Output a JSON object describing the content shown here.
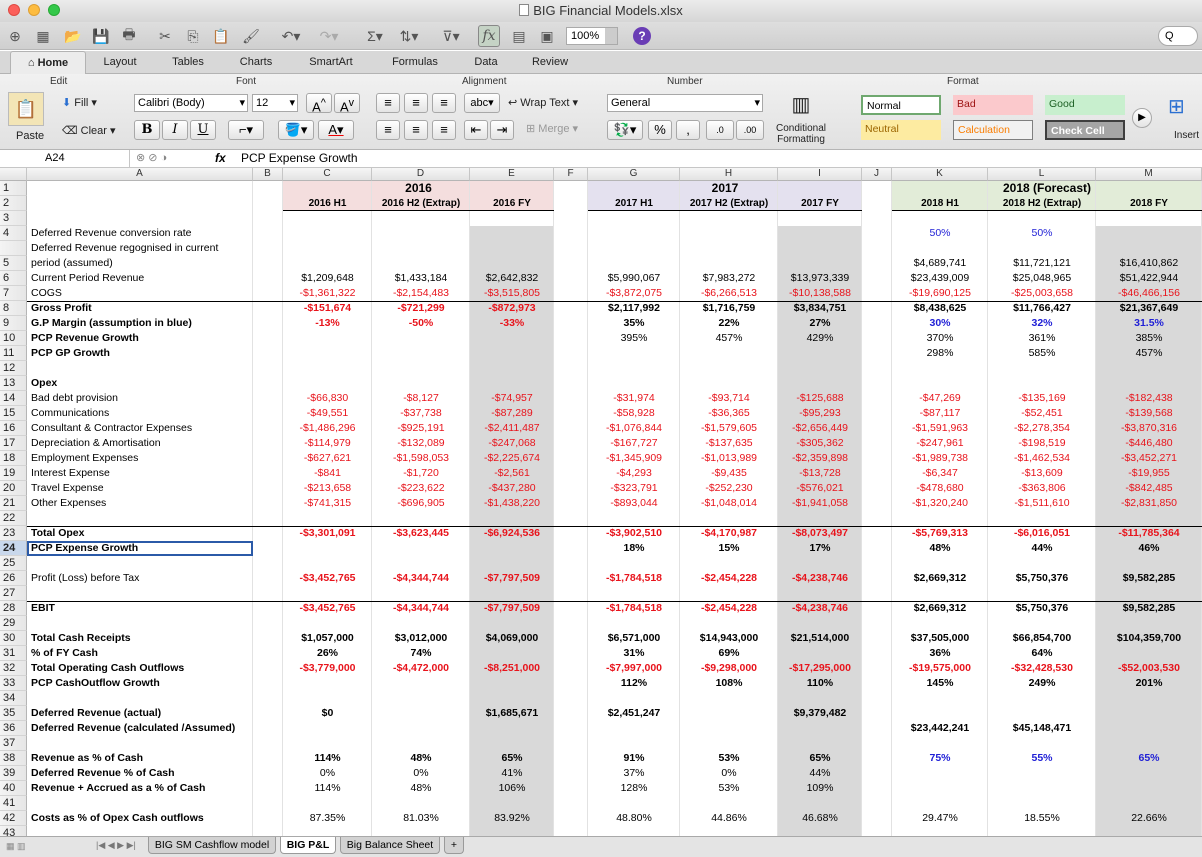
{
  "window": {
    "title": "BIG Financial Models.xlsx"
  },
  "toolbar": {
    "zoom": "100%",
    "search_placeholder": "Q"
  },
  "ribbon_tabs": [
    "Home",
    "Layout",
    "Tables",
    "Charts",
    "SmartArt",
    "Formulas",
    "Data",
    "Review"
  ],
  "ribbon": {
    "groups": {
      "edit": "Edit",
      "font": "Font",
      "alignment": "Alignment",
      "number": "Number",
      "format": "Format"
    },
    "paste": "Paste",
    "fill": "Fill",
    "clear": "Clear",
    "font_name": "Calibri (Body)",
    "font_size": "12",
    "wrap_text": "Wrap Text",
    "merge": "Merge",
    "abc": "abc",
    "number_format": "General",
    "conditional_formatting": "Conditional Formatting",
    "styles": {
      "normal": "Normal",
      "bad": "Bad",
      "good": "Good",
      "neutral": "Neutral",
      "calculation": "Calculation",
      "check_cell": "Check Cell"
    },
    "insert": "Insert"
  },
  "formula_bar": {
    "cell_ref": "A24",
    "fx": "fx",
    "content": "PCP Expense Growth"
  },
  "columns": [
    "A",
    "B",
    "C",
    "D",
    "E",
    "F",
    "G",
    "H",
    "I",
    "J",
    "K",
    "L",
    "M"
  ],
  "header": {
    "year2016": "2016",
    "year2017": "2017",
    "year2018": "2018 (Forecast)",
    "c": "2016 H1",
    "d": "2016 H2 (Extrap)",
    "e": "2016 FY",
    "g": "2017 H1",
    "h": "2017 H2 (Extrap)",
    "i": "2017 FY",
    "k": "2018 H1",
    "l": "2018 H2 (Extrap)",
    "m": "2018 FY"
  },
  "labels": {
    "r4": "Deferred Revenue conversion rate",
    "r5a": "Deferred Revenue regognised in current",
    "r5b": "period (assumed)",
    "r6": "Current Period Revenue",
    "r7": "COGS",
    "r8": "Gross Profit",
    "r9": "G.P Margin (assumption in blue)",
    "r10": "PCP Revenue Growth",
    "r11": "PCP GP Growth",
    "r13": "Opex",
    "r14": "Bad debt provision",
    "r15": "Communications",
    "r16": "Consultant & Contractor Expenses",
    "r17": "Depreciation & Amortisation",
    "r18": "Employment Expenses",
    "r19": "Interest Expense",
    "r20": "Travel Expense",
    "r21": "Other Expenses",
    "r23": "Total Opex",
    "r24": "PCP Expense Growth",
    "r26": "Profit (Loss) before Tax",
    "r28": "EBIT",
    "r30": "Total Cash Receipts",
    "r31": "% of FY Cash",
    "r32": "Total Operating Cash Outflows",
    "r33": "PCP CashOutflow Growth",
    "r35": "Deferred Revenue (actual)",
    "r36": "Deferred Revenue (calculated /Assumed)",
    "r38": "Revenue as % of Cash",
    "r39": "Deferred Revenue % of Cash",
    "r40": "Revenue + Accrued as a % of Cash",
    "r42": "Costs as % of Opex Cash outflows"
  },
  "cells": {
    "k4": "50%",
    "l4": "50%",
    "k5": "$4,689,741",
    "l5": "$11,721,121",
    "m5": "$16,410,862",
    "c6": "$1,209,648",
    "d6": "$1,433,184",
    "e6": "$2,642,832",
    "g6": "$5,990,067",
    "h6": "$7,983,272",
    "i6": "$13,973,339",
    "k6": "$23,439,009",
    "l6": "$25,048,965",
    "m6": "$51,422,944",
    "c7": "-$1,361,322",
    "d7": "-$2,154,483",
    "e7": "-$3,515,805",
    "g7": "-$3,872,075",
    "h7": "-$6,266,513",
    "i7": "-$10,138,588",
    "k7": "-$19,690,125",
    "l7": "-$25,003,658",
    "m7": "-$46,466,156",
    "c8": "-$151,674",
    "d8": "-$721,299",
    "e8": "-$872,973",
    "g8": "$2,117,992",
    "h8": "$1,716,759",
    "i8": "$3,834,751",
    "k8": "$8,438,625",
    "l8": "$11,766,427",
    "m8": "$21,367,649",
    "c9": "-13%",
    "d9": "-50%",
    "e9": "-33%",
    "g9": "35%",
    "h9": "22%",
    "i9": "27%",
    "k9": "30%",
    "l9": "32%",
    "m9": "31.5%",
    "g10": "395%",
    "h10": "457%",
    "i10": "429%",
    "k10": "370%",
    "l10": "361%",
    "m10": "385%",
    "k11": "298%",
    "l11": "585%",
    "m11": "457%",
    "c14": "-$66,830",
    "d14": "-$8,127",
    "e14": "-$74,957",
    "g14": "-$31,974",
    "h14": "-$93,714",
    "i14": "-$125,688",
    "k14": "-$47,269",
    "l14": "-$135,169",
    "m14": "-$182,438",
    "c15": "-$49,551",
    "d15": "-$37,738",
    "e15": "-$87,289",
    "g15": "-$58,928",
    "h15": "-$36,365",
    "i15": "-$95,293",
    "k15": "-$87,117",
    "l15": "-$52,451",
    "m15": "-$139,568",
    "c16": "-$1,486,296",
    "d16": "-$925,191",
    "e16": "-$2,411,487",
    "g16": "-$1,076,844",
    "h16": "-$1,579,605",
    "i16": "-$2,656,449",
    "k16": "-$1,591,963",
    "l16": "-$2,278,354",
    "m16": "-$3,870,316",
    "c17": "-$114,979",
    "d17": "-$132,089",
    "e17": "-$247,068",
    "g17": "-$167,727",
    "h17": "-$137,635",
    "i17": "-$305,362",
    "k17": "-$247,961",
    "l17": "-$198,519",
    "m17": "-$446,480",
    "c18": "-$627,621",
    "d18": "-$1,598,053",
    "e18": "-$2,225,674",
    "g18": "-$1,345,909",
    "h18": "-$1,013,989",
    "i18": "-$2,359,898",
    "k18": "-$1,989,738",
    "l18": "-$1,462,534",
    "m18": "-$3,452,271",
    "c19": "-$841",
    "d19": "-$1,720",
    "e19": "-$2,561",
    "g19": "-$4,293",
    "h19": "-$9,435",
    "i19": "-$13,728",
    "k19": "-$6,347",
    "l19": "-$13,609",
    "m19": "-$19,955",
    "c20": "-$213,658",
    "d20": "-$223,622",
    "e20": "-$437,280",
    "g20": "-$323,791",
    "h20": "-$252,230",
    "i20": "-$576,021",
    "k20": "-$478,680",
    "l20": "-$363,806",
    "m20": "-$842,485",
    "c21": "-$741,315",
    "d21": "-$696,905",
    "e21": "-$1,438,220",
    "g21": "-$893,044",
    "h21": "-$1,048,014",
    "i21": "-$1,941,058",
    "k21": "-$1,320,240",
    "l21": "-$1,511,610",
    "m21": "-$2,831,850",
    "c23": "-$3,301,091",
    "d23": "-$3,623,445",
    "e23": "-$6,924,536",
    "g23": "-$3,902,510",
    "h23": "-$4,170,987",
    "i23": "-$8,073,497",
    "k23": "-$5,769,313",
    "l23": "-$6,016,051",
    "m23": "-$11,785,364",
    "g24": "18%",
    "h24": "15%",
    "i24": "17%",
    "k24": "48%",
    "l24": "44%",
    "m24": "46%",
    "c26": "-$3,452,765",
    "d26": "-$4,344,744",
    "e26": "-$7,797,509",
    "g26": "-$1,784,518",
    "h26": "-$2,454,228",
    "i26": "-$4,238,746",
    "k26": "$2,669,312",
    "l26": "$5,750,376",
    "m26": "$9,582,285",
    "c28": "-$3,452,765",
    "d28": "-$4,344,744",
    "e28": "-$7,797,509",
    "g28": "-$1,784,518",
    "h28": "-$2,454,228",
    "i28": "-$4,238,746",
    "k28": "$2,669,312",
    "l28": "$5,750,376",
    "m28": "$9,582,285",
    "c30": "$1,057,000",
    "d30": "$3,012,000",
    "e30": "$4,069,000",
    "g30": "$6,571,000",
    "h30": "$14,943,000",
    "i30": "$21,514,000",
    "k30": "$37,505,000",
    "l30": "$66,854,700",
    "m30": "$104,359,700",
    "c31": "26%",
    "d31": "74%",
    "g31": "31%",
    "h31": "69%",
    "k31": "36%",
    "l31": "64%",
    "c32": "-$3,779,000",
    "d32": "-$4,472,000",
    "e32": "-$8,251,000",
    "g32": "-$7,997,000",
    "h32": "-$9,298,000",
    "i32": "-$17,295,000",
    "k32": "-$19,575,000",
    "l32": "-$32,428,530",
    "m32": "-$52,003,530",
    "g33": "112%",
    "h33": "108%",
    "i33": "110%",
    "k33": "145%",
    "l33": "249%",
    "m33": "201%",
    "c35": "$0",
    "e35": "$1,685,671",
    "g35": "$2,451,247",
    "i35": "$9,379,482",
    "k36": "$23,442,241",
    "l36": "$45,148,471",
    "c38": "114%",
    "d38": "48%",
    "e38": "65%",
    "g38": "91%",
    "h38": "53%",
    "i38": "65%",
    "k38": "75%",
    "l38": "55%",
    "m38": "65%",
    "c39": "0%",
    "d39": "0%",
    "e39": "41%",
    "g39": "37%",
    "h39": "0%",
    "i39": "44%",
    "c40": "114%",
    "d40": "48%",
    "e40": "106%",
    "g40": "128%",
    "h40": "53%",
    "i40": "109%",
    "c42": "87.35%",
    "d42": "81.03%",
    "e42": "83.92%",
    "g42": "48.80%",
    "h42": "44.86%",
    "i42": "46.68%",
    "k42": "29.47%",
    "l42": "18.55%",
    "m42": "22.66%"
  },
  "rows": [
    "1",
    "2",
    "3",
    "4",
    "",
    "5",
    "6",
    "7",
    "8",
    "9",
    "10",
    "11",
    "12",
    "13",
    "14",
    "15",
    "16",
    "17",
    "18",
    "19",
    "20",
    "21",
    "22",
    "23",
    "24",
    "25",
    "26",
    "27",
    "28",
    "29",
    "30",
    "31",
    "32",
    "33",
    "34",
    "35",
    "36",
    "37",
    "38",
    "39",
    "40",
    "41",
    "42",
    "43"
  ],
  "sheet_tabs": [
    "BIG SM Cashflow model",
    "BIG P&L",
    "Big Balance Sheet",
    "+"
  ],
  "colors": {
    "negative": "#e8141c",
    "assumption": "#1f1fd6",
    "shade": "#d9d9d9",
    "y2016": "#f4dede",
    "y2017": "#e4e1ef",
    "y2018": "#e2ecd8"
  }
}
